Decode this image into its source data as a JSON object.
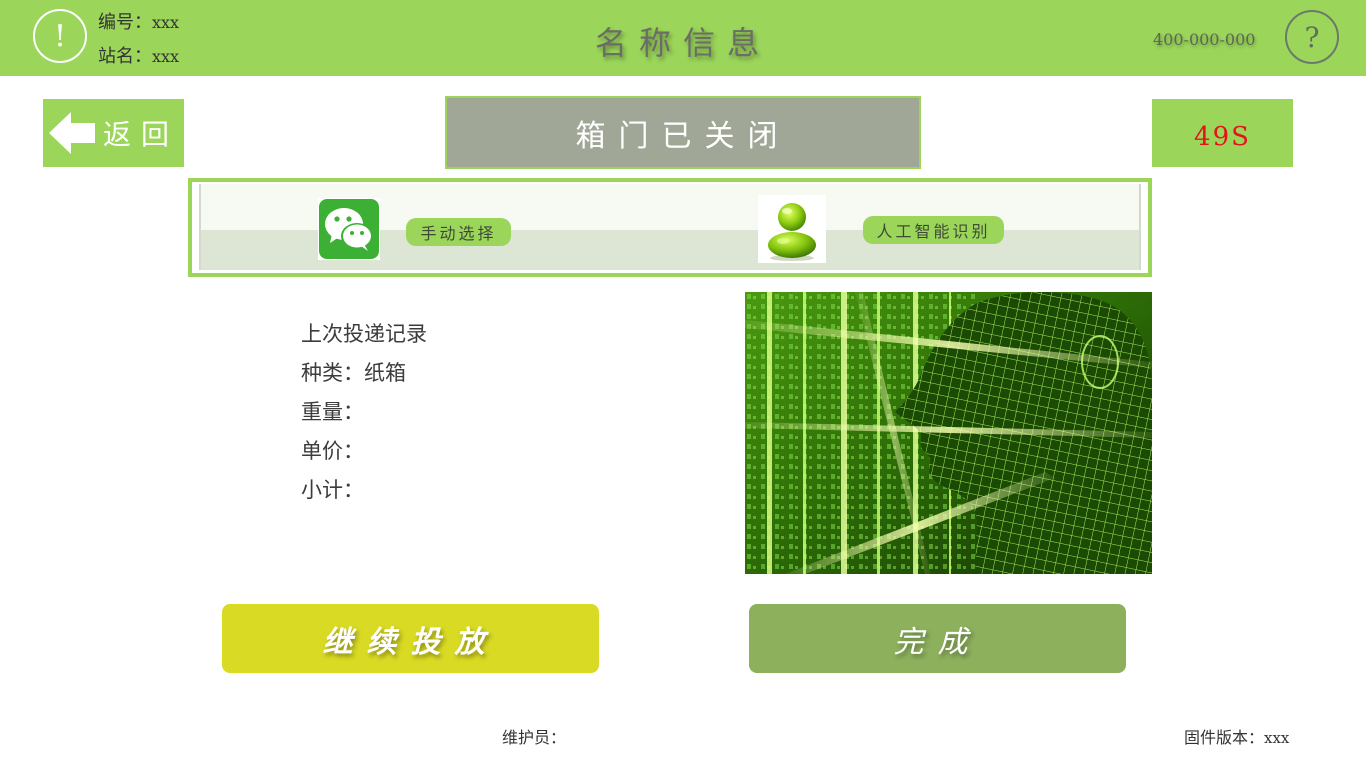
{
  "header": {
    "id_label": "编号：",
    "id_value": "xxx",
    "station_label": "站名：",
    "station_value": "xxx",
    "title": "名称信息",
    "phone": "400-000-000",
    "warning_glyph": "!",
    "help_glyph": "?",
    "background": "#9bd65a"
  },
  "back_button": {
    "label": "返回",
    "icon": "arrow-left-icon"
  },
  "status": {
    "text": "箱门已关闭"
  },
  "countdown": {
    "text": "49S",
    "color": "#e2141a"
  },
  "modes": {
    "manual": {
      "label": "手动选择",
      "icon": "wechat-icon"
    },
    "ai": {
      "label": "人工智能识别",
      "icon": "ai-person-icon"
    }
  },
  "record": {
    "title": "上次投递记录",
    "type_label": "种类：",
    "type_value": "纸箱",
    "weight_label": "重量：",
    "unit_price_label": "单价：",
    "subtotal_label": "小计："
  },
  "buttons": {
    "continue_label": "继续投放",
    "done_label": "完成",
    "continue_color": "#d9da23",
    "done_color": "#8cb05c"
  },
  "footer": {
    "maintainer_label": "维护员：",
    "firmware_label": "固件版本：",
    "firmware_value": "xxx"
  }
}
